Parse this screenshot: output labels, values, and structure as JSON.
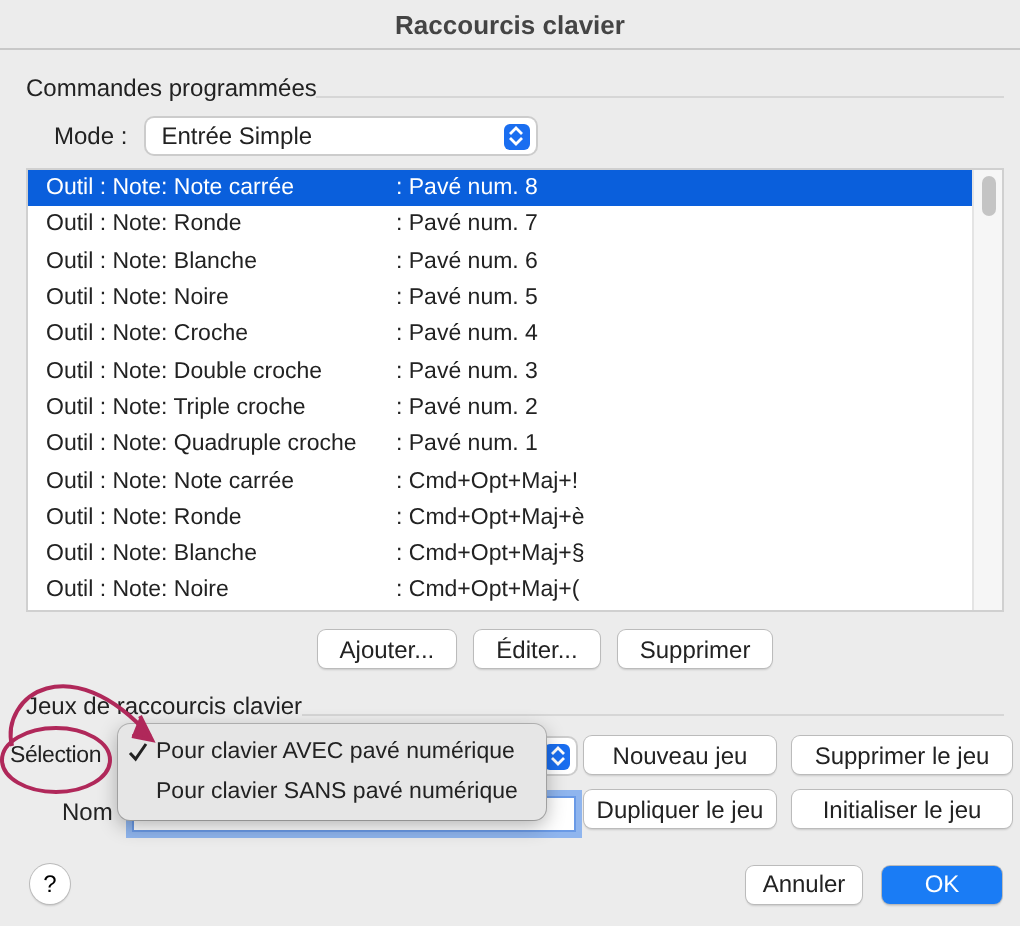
{
  "window": {
    "title": "Raccourcis clavier"
  },
  "commands_section": {
    "title": "Commandes programmées",
    "mode_label": "Mode :",
    "mode_value": "Entrée Simple",
    "rows": [
      {
        "command": "Outil : Note: Note carrée",
        "shortcut": ": Pavé num. 8",
        "selected": true
      },
      {
        "command": "Outil : Note: Ronde",
        "shortcut": ": Pavé num. 7",
        "selected": false
      },
      {
        "command": "Outil : Note: Blanche",
        "shortcut": ": Pavé num. 6",
        "selected": false
      },
      {
        "command": "Outil : Note: Noire",
        "shortcut": ": Pavé num. 5",
        "selected": false
      },
      {
        "command": "Outil : Note: Croche",
        "shortcut": ": Pavé num. 4",
        "selected": false
      },
      {
        "command": "Outil : Note: Double croche",
        "shortcut": ": Pavé num. 3",
        "selected": false
      },
      {
        "command": "Outil : Note: Triple croche",
        "shortcut": ": Pavé num. 2",
        "selected": false
      },
      {
        "command": "Outil : Note: Quadruple croche",
        "shortcut": ": Pavé num. 1",
        "selected": false
      },
      {
        "command": "Outil : Note: Note carrée",
        "shortcut": ": Cmd+Opt+Maj+!",
        "selected": false
      },
      {
        "command": "Outil : Note: Ronde",
        "shortcut": ": Cmd+Opt+Maj+è",
        "selected": false
      },
      {
        "command": "Outil : Note: Blanche",
        "shortcut": ": Cmd+Opt+Maj+§",
        "selected": false
      },
      {
        "command": "Outil : Note: Noire",
        "shortcut": ": Cmd+Opt+Maj+(",
        "selected": false
      }
    ],
    "buttons": [
      "Ajouter...",
      "Éditer...",
      "Supprimer"
    ]
  },
  "sets_section": {
    "title": "Jeux de raccourcis clavier",
    "selection_label": "Sélection",
    "name_label": "Nom",
    "menu": [
      {
        "label": "Pour clavier AVEC pavé numérique",
        "selected": true
      },
      {
        "label": "Pour clavier SANS pavé numérique",
        "selected": false
      }
    ],
    "buttons": [
      "Nouveau jeu",
      "Supprimer le jeu",
      "Dupliquer le jeu",
      "Initialiser le jeu"
    ]
  },
  "footer": {
    "help": "?",
    "buttons": [
      {
        "label": "Annuler",
        "kind": "normal"
      },
      {
        "label": "OK",
        "kind": "default"
      }
    ]
  }
}
